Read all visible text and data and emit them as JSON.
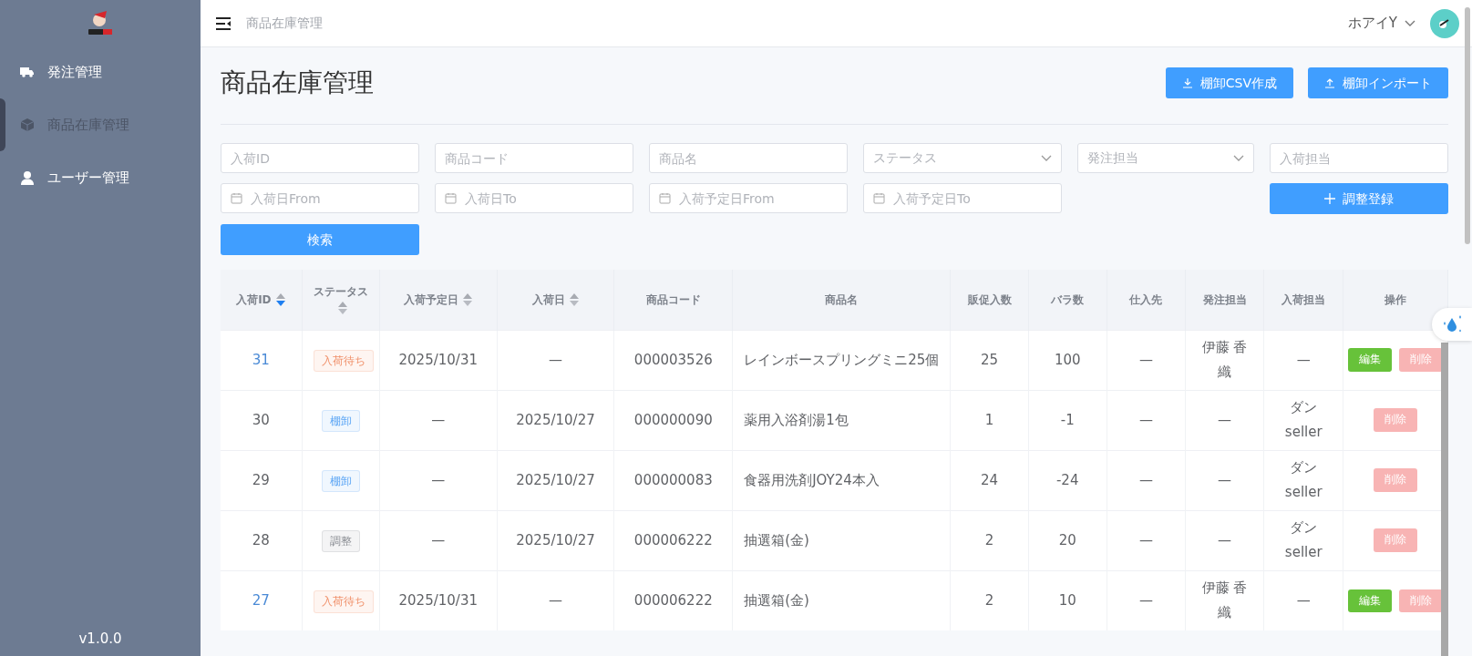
{
  "sidebar": {
    "items": [
      {
        "label": "発注管理",
        "selected": false
      },
      {
        "label": "商品在庫管理",
        "selected": true
      },
      {
        "label": "ユーザー管理",
        "selected": false
      }
    ],
    "version": "v1.0.0"
  },
  "header": {
    "breadcrumb": "商品在庫管理",
    "user": "ホアイY"
  },
  "page": {
    "title": "商品在庫管理",
    "actions": [
      {
        "label": "棚卸CSV作成",
        "kind": "download"
      },
      {
        "label": "棚卸インポート",
        "kind": "upload"
      }
    ]
  },
  "filters": [
    {
      "kind": "text",
      "placeholder": "入荷ID"
    },
    {
      "kind": "text",
      "placeholder": "商品コード"
    },
    {
      "kind": "text",
      "placeholder": "商品名"
    },
    {
      "kind": "select",
      "placeholder": "ステータス"
    },
    {
      "kind": "select",
      "placeholder": "発注担当"
    },
    {
      "kind": "text",
      "placeholder": "入荷担当"
    },
    {
      "kind": "date",
      "placeholder": "入荷日From"
    },
    {
      "kind": "date",
      "placeholder": "入荷日To"
    },
    {
      "kind": "date",
      "placeholder": "入荷予定日From"
    },
    {
      "kind": "date",
      "placeholder": "入荷予定日To"
    }
  ],
  "add_button": "調整登録",
  "search_button": "検索",
  "table": {
    "columns": [
      {
        "label": "入荷ID",
        "sortable": true,
        "sorted_desc": true
      },
      {
        "label": "ステータス",
        "sortable": true,
        "sorted_desc": false
      },
      {
        "label": "入荷予定日",
        "sortable": true,
        "sorted_desc": false
      },
      {
        "label": "入荷日",
        "sortable": true,
        "sorted_desc": false
      },
      {
        "label": "商品コード",
        "sortable": false,
        "sorted_desc": false
      },
      {
        "label": "商品名",
        "sortable": false,
        "sorted_desc": false
      },
      {
        "label": "販促入数",
        "sortable": false,
        "sorted_desc": false
      },
      {
        "label": "バラ数",
        "sortable": false,
        "sorted_desc": false
      },
      {
        "label": "仕入先",
        "sortable": false,
        "sorted_desc": false
      },
      {
        "label": "発注担当",
        "sortable": false,
        "sorted_desc": false
      },
      {
        "label": "入荷担当",
        "sortable": false,
        "sorted_desc": false
      },
      {
        "label": "操作",
        "sortable": false,
        "sorted_desc": false
      }
    ],
    "rows": [
      {
        "cells": [
          {
            "kind": "link",
            "text": "31"
          },
          {
            "kind": "status",
            "text": "入荷待ち",
            "color": "#f0906a"
          },
          {
            "kind": "text",
            "text": "2025/10/31"
          },
          {
            "kind": "text",
            "text": "—"
          },
          {
            "kind": "text",
            "text": "000003526"
          },
          {
            "kind": "text",
            "text": "レインボースプリングミニ25個"
          },
          {
            "kind": "text",
            "text": "25"
          },
          {
            "kind": "text",
            "text": "100"
          },
          {
            "kind": "text",
            "text": "—"
          },
          {
            "kind": "text",
            "text": "伊藤 香織"
          },
          {
            "kind": "text",
            "text": "—"
          },
          {
            "kind": "actions",
            "buttons": [
              {
                "label": "編集",
                "kind": "edit"
              },
              {
                "label": "削除",
                "kind": "delete"
              }
            ]
          }
        ]
      },
      {
        "cells": [
          {
            "kind": "text",
            "text": "30"
          },
          {
            "kind": "status",
            "text": "棚卸",
            "color": "#5ea7f5"
          },
          {
            "kind": "text",
            "text": "—"
          },
          {
            "kind": "text",
            "text": "2025/10/27"
          },
          {
            "kind": "text",
            "text": "000000090"
          },
          {
            "kind": "text",
            "text": "薬用入浴剤湯1包"
          },
          {
            "kind": "text",
            "text": "1"
          },
          {
            "kind": "text",
            "text": "-1"
          },
          {
            "kind": "text",
            "text": "—"
          },
          {
            "kind": "text",
            "text": "—"
          },
          {
            "kind": "text",
            "text": "ダン seller"
          },
          {
            "kind": "actions",
            "buttons": [
              {
                "label": "削除",
                "kind": "delete"
              }
            ]
          }
        ]
      },
      {
        "cells": [
          {
            "kind": "text",
            "text": "29"
          },
          {
            "kind": "status",
            "text": "棚卸",
            "color": "#5ea7f5"
          },
          {
            "kind": "text",
            "text": "—"
          },
          {
            "kind": "text",
            "text": "2025/10/27"
          },
          {
            "kind": "text",
            "text": "000000083"
          },
          {
            "kind": "text",
            "text": "食器用洗剤JOY24本入"
          },
          {
            "kind": "text",
            "text": "24"
          },
          {
            "kind": "text",
            "text": "-24"
          },
          {
            "kind": "text",
            "text": "—"
          },
          {
            "kind": "text",
            "text": "—"
          },
          {
            "kind": "text",
            "text": "ダン seller"
          },
          {
            "kind": "actions",
            "buttons": [
              {
                "label": "削除",
                "kind": "delete"
              }
            ]
          }
        ]
      },
      {
        "cells": [
          {
            "kind": "text",
            "text": "28"
          },
          {
            "kind": "status",
            "text": "調整",
            "color": "#8c8f95"
          },
          {
            "kind": "text",
            "text": "—"
          },
          {
            "kind": "text",
            "text": "2025/10/27"
          },
          {
            "kind": "text",
            "text": "000006222"
          },
          {
            "kind": "text",
            "text": "抽選箱(金)"
          },
          {
            "kind": "text",
            "text": "2"
          },
          {
            "kind": "text",
            "text": "20"
          },
          {
            "kind": "text",
            "text": "—"
          },
          {
            "kind": "text",
            "text": "—"
          },
          {
            "kind": "text",
            "text": "ダン seller"
          },
          {
            "kind": "actions",
            "buttons": [
              {
                "label": "削除",
                "kind": "delete"
              }
            ]
          }
        ]
      },
      {
        "cells": [
          {
            "kind": "link",
            "text": "27"
          },
          {
            "kind": "status",
            "text": "入荷待ち",
            "color": "#f0906a"
          },
          {
            "kind": "text",
            "text": "2025/10/31"
          },
          {
            "kind": "text",
            "text": "—"
          },
          {
            "kind": "text",
            "text": "000006222"
          },
          {
            "kind": "text",
            "text": "抽選箱(金)"
          },
          {
            "kind": "text",
            "text": "2"
          },
          {
            "kind": "text",
            "text": "10"
          },
          {
            "kind": "text",
            "text": "—"
          },
          {
            "kind": "text",
            "text": "伊藤 香織"
          },
          {
            "kind": "text",
            "text": "—"
          },
          {
            "kind": "actions",
            "buttons": [
              {
                "label": "編集",
                "kind": "edit"
              },
              {
                "label": "削除",
                "kind": "delete"
              }
            ]
          }
        ]
      }
    ]
  }
}
